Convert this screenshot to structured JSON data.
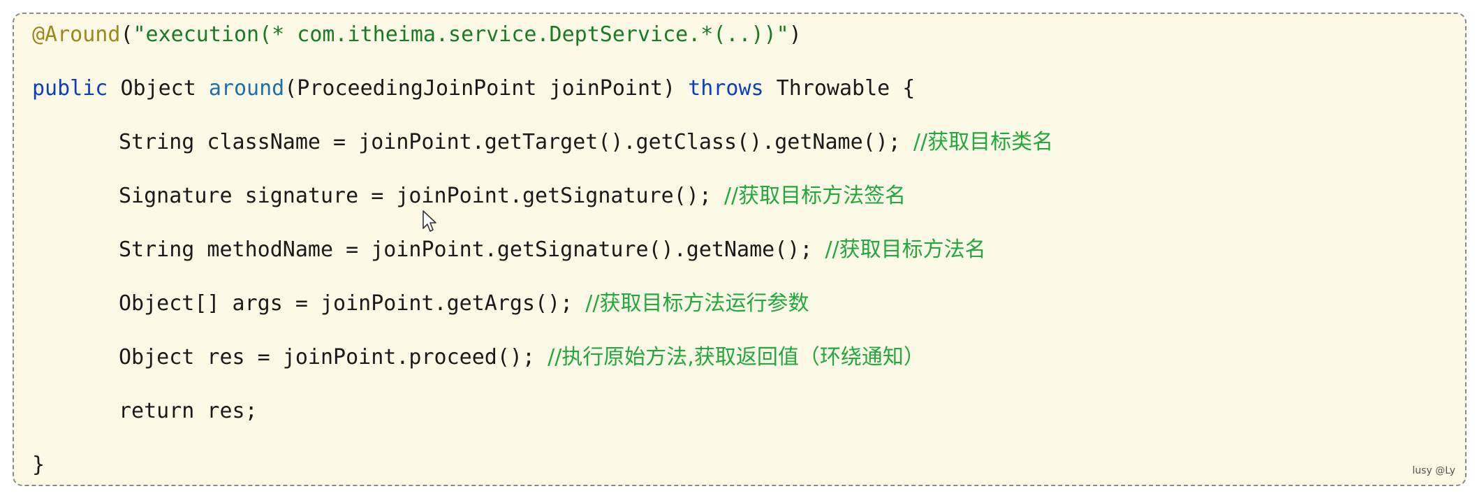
{
  "code": {
    "annotation": {
      "name": "@Around",
      "open": "(",
      "value": "\"execution(* com.itheima.service.DeptService.*(..))\"",
      "close": ")"
    },
    "signature": {
      "modifier": "public",
      "return_type": "Object",
      "method_name": "around",
      "params": "(ProceedingJoinPoint joinPoint)",
      "throws_kw": "throws",
      "exception": "Throwable",
      "brace": "{"
    },
    "statements": [
      {
        "code": "String className = joinPoint.getTarget().getClass().getName(); ",
        "comment": "//获取目标类名"
      },
      {
        "code": "Signature signature = joinPoint.getSignature(); ",
        "comment": "//获取目标方法签名"
      },
      {
        "code": "String methodName = joinPoint.getSignature().getName(); ",
        "comment": "//获取目标方法名"
      },
      {
        "code": "Object[] args = joinPoint.getArgs(); ",
        "comment": "//获取目标方法运行参数"
      },
      {
        "code": "Object res = joinPoint.proceed(); ",
        "comment": "//执行原始方法,获取返回值（环绕通知）"
      }
    ],
    "return_stmt": "return res;",
    "closing_brace": "}"
  },
  "watermark": "lusy @Ly",
  "icons": {
    "cursor": "mouse-pointer-icon"
  },
  "colors": {
    "background": "#fcfae6",
    "border": "#8a8a8a",
    "annotation": "#9b8a1c",
    "string": "#1a7a26",
    "keyword": "#0b3fbf",
    "method_name": "#1f6fa8",
    "comment": "#22a83d",
    "text": "#1a1a1a"
  }
}
